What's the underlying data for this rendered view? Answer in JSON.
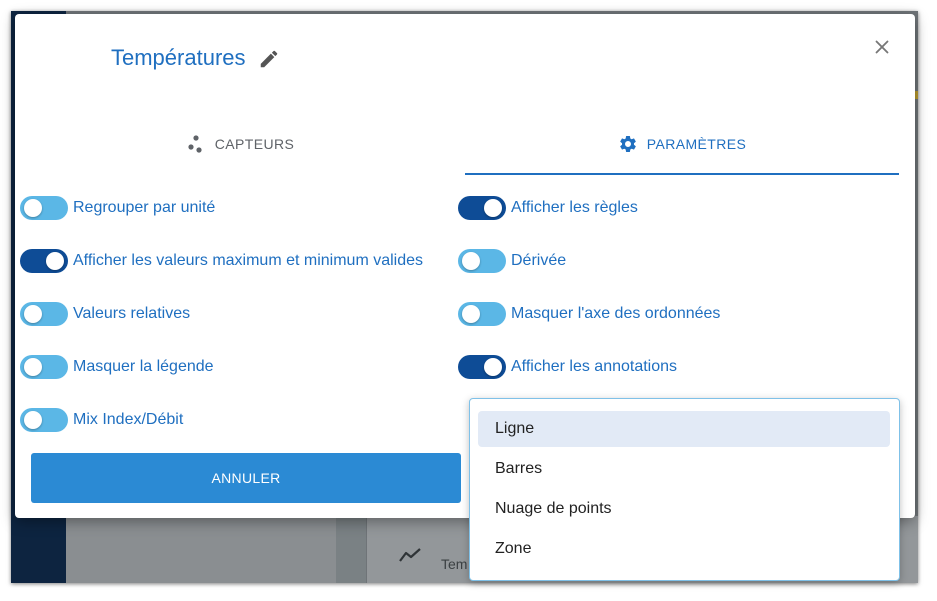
{
  "dialog": {
    "title": "Températures",
    "tabs": [
      {
        "label": "CAPTEURS",
        "icon": "scatter-dots-icon",
        "active": false
      },
      {
        "label": "PARAMÈTRES",
        "icon": "gear-icon",
        "active": true
      }
    ],
    "left_toggles": [
      {
        "label": "Regrouper par unité",
        "on": false
      },
      {
        "label": "Afficher les valeurs maximum et minimum valides",
        "on": true
      },
      {
        "label": "Valeurs relatives",
        "on": false
      },
      {
        "label": "Masquer la légende",
        "on": false
      },
      {
        "label": "Mix Index/Débit",
        "on": false
      }
    ],
    "right_toggles": [
      {
        "label": "Afficher les règles",
        "on": true
      },
      {
        "label": "Dérivée",
        "on": false
      },
      {
        "label": "Masquer l'axe des ordonnées",
        "on": false
      },
      {
        "label": "Afficher les annotations",
        "on": true
      }
    ],
    "cancel_label": "ANNULER"
  },
  "chart_type_menu": {
    "selected": "Ligne",
    "options": [
      "Ligne",
      "Barres",
      "Nuage de points",
      "Zone"
    ]
  },
  "background": {
    "visible_text": "Tem"
  },
  "colors": {
    "accent": "#1f6fc0",
    "toggle_on": "#0e4c96",
    "toggle_off": "#5bb7e6",
    "button": "#2b8ad4"
  }
}
